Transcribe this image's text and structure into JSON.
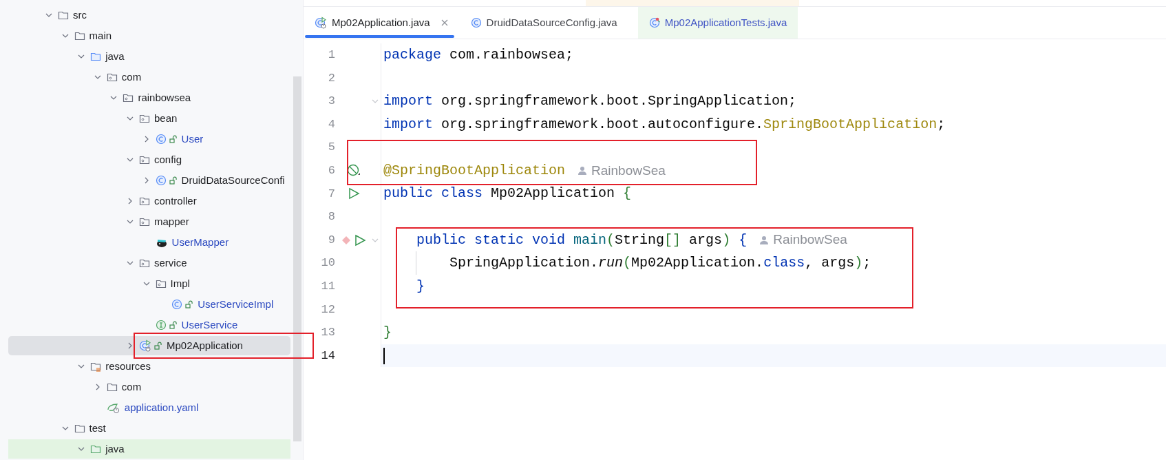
{
  "project_tree": {
    "items": [
      {
        "label": "src",
        "kind": "folder",
        "expanded": true,
        "selected": false,
        "children": [
          {
            "label": "main",
            "kind": "folder",
            "expanded": true,
            "selected": false,
            "children": [
              {
                "label": "java",
                "kind": "source-root",
                "expanded": true,
                "selected": false,
                "children": [
                  {
                    "label": "com",
                    "kind": "package",
                    "expanded": true,
                    "selected": false,
                    "children": [
                      {
                        "label": "rainbowsea",
                        "kind": "package",
                        "expanded": true,
                        "selected": false,
                        "children": [
                          {
                            "label": "bean",
                            "kind": "package",
                            "expanded": true,
                            "selected": false,
                            "children": [
                              {
                                "label": "User",
                                "kind": "class",
                                "expanded": false,
                                "selected": false,
                                "modified": true
                              }
                            ]
                          },
                          {
                            "label": "config",
                            "kind": "package",
                            "expanded": true,
                            "selected": false,
                            "children": [
                              {
                                "label": "DruidDataSourceConfi",
                                "kind": "class",
                                "expanded": false,
                                "selected": false,
                                "modified": false
                              }
                            ]
                          },
                          {
                            "label": "controller",
                            "kind": "package",
                            "expanded": false,
                            "selected": false
                          },
                          {
                            "label": "mapper",
                            "kind": "package",
                            "expanded": true,
                            "selected": false,
                            "children": [
                              {
                                "label": "UserMapper",
                                "kind": "mapper",
                                "selected": false,
                                "modified": true
                              }
                            ]
                          },
                          {
                            "label": "service",
                            "kind": "package",
                            "expanded": true,
                            "selected": false,
                            "children": [
                              {
                                "label": "Impl",
                                "kind": "package",
                                "expanded": true,
                                "selected": false,
                                "children": [
                                  {
                                    "label": "UserServiceImpl",
                                    "kind": "class",
                                    "selected": false,
                                    "modified": true
                                  }
                                ]
                              },
                              {
                                "label": "UserService",
                                "kind": "interface",
                                "selected": false,
                                "modified": true
                              }
                            ]
                          },
                          {
                            "label": "Mp02Application",
                            "kind": "app-class",
                            "expanded": false,
                            "selected": true,
                            "modified": false
                          }
                        ]
                      }
                    ]
                  }
                ]
              },
              {
                "label": "resources",
                "kind": "resources-root",
                "expanded": true,
                "selected": false,
                "children": [
                  {
                    "label": "com",
                    "kind": "folder",
                    "expanded": false,
                    "selected": false
                  },
                  {
                    "label": "application.yaml",
                    "kind": "yaml",
                    "selected": false,
                    "modified": true
                  }
                ]
              }
            ]
          },
          {
            "label": "test",
            "kind": "folder",
            "expanded": true,
            "selected": false,
            "children": [
              {
                "label": "java",
                "kind": "test-source-root",
                "expanded": true,
                "selected": false
              }
            ]
          }
        ]
      }
    ]
  },
  "editor": {
    "tabs": [
      {
        "label": "Mp02Application.java",
        "kind": "runnable",
        "selected": true,
        "closable": true,
        "modified": false
      },
      {
        "label": "DruidDataSourceConfig.java",
        "kind": "class",
        "selected": false,
        "closable": false,
        "modified": false
      },
      {
        "label": "Mp02ApplicationTests.java",
        "kind": "test",
        "selected": false,
        "closable": false,
        "modified": true
      }
    ],
    "lines": [
      {
        "number": "1",
        "current": false,
        "run": false,
        "bean_marker": false,
        "breakpoint": false,
        "fold": false,
        "tokens": [
          {
            "text": "package",
            "kind": "keyword"
          },
          {
            "text": " com.rainbowsea;",
            "kind": "plain"
          }
        ]
      },
      {
        "number": "2",
        "current": false,
        "run": false,
        "bean_marker": false,
        "breakpoint": false,
        "fold": false
      },
      {
        "number": "3",
        "current": false,
        "run": false,
        "bean_marker": false,
        "breakpoint": false,
        "fold": true,
        "tokens": [
          {
            "text": "import",
            "kind": "keyword"
          },
          {
            "text": " org.springframework.boot.SpringApplication;",
            "kind": "plain"
          }
        ]
      },
      {
        "number": "4",
        "current": false,
        "run": false,
        "bean_marker": false,
        "breakpoint": false,
        "fold": false,
        "tokens": [
          {
            "text": "import",
            "kind": "keyword"
          },
          {
            "text": " org.springframework.boot.autoconfigure.",
            "kind": "plain"
          },
          {
            "text": "SpringBootApplication",
            "kind": "annotation"
          },
          {
            "text": ";",
            "kind": "plain"
          }
        ]
      },
      {
        "number": "5",
        "current": false,
        "run": false,
        "bean_marker": false,
        "breakpoint": false,
        "fold": false
      },
      {
        "number": "6",
        "current": false,
        "run": false,
        "bean_marker": true,
        "breakpoint": false,
        "fold": false,
        "tokens": [
          {
            "text": "@SpringBootApplication",
            "kind": "annotation"
          },
          {
            "text": "RainbowSea",
            "kind": "author"
          }
        ]
      },
      {
        "number": "7",
        "current": false,
        "run": true,
        "bean_marker": false,
        "breakpoint": false,
        "fold": false,
        "tokens": [
          {
            "text": "public class",
            "kind": "keyword"
          },
          {
            "text": " Mp02Application ",
            "kind": "plain"
          },
          {
            "text": "{",
            "kind": "bracket"
          }
        ]
      },
      {
        "number": "8",
        "current": false,
        "run": false,
        "bean_marker": false,
        "breakpoint": false,
        "fold": false
      },
      {
        "number": "9",
        "current": false,
        "run": true,
        "bean_marker": false,
        "breakpoint": true,
        "fold": true,
        "tokens": [
          {
            "text": "    public static void",
            "kind": "keyword"
          },
          {
            "text": " main",
            "kind": "method"
          },
          {
            "text": "(",
            "kind": "bracket"
          },
          {
            "text": "String",
            "kind": "plain"
          },
          {
            "text": "[]",
            "kind": "bracket"
          },
          {
            "text": " args",
            "kind": "plain"
          },
          {
            "text": ")",
            "kind": "bracket"
          },
          {
            "text": " {",
            "kind": "brace"
          },
          {
            "text": "RainbowSea",
            "kind": "author"
          }
        ]
      },
      {
        "number": "10",
        "current": false,
        "run": false,
        "bean_marker": false,
        "breakpoint": false,
        "fold": false,
        "guide": true,
        "tokens": [
          {
            "text": "        SpringApplication.",
            "kind": "plain"
          },
          {
            "text": "run",
            "kind": "italic"
          },
          {
            "text": "(",
            "kind": "bracket"
          },
          {
            "text": "Mp02Application.",
            "kind": "plain"
          },
          {
            "text": "class",
            "kind": "keyword"
          },
          {
            "text": ", args",
            "kind": "plain"
          },
          {
            "text": ")",
            "kind": "bracket"
          },
          {
            "text": ";",
            "kind": "plain"
          }
        ]
      },
      {
        "number": "11",
        "current": false,
        "run": false,
        "bean_marker": false,
        "breakpoint": false,
        "fold": false,
        "tokens": [
          {
            "text": "    }",
            "kind": "brace"
          }
        ]
      },
      {
        "number": "12",
        "current": false,
        "run": false,
        "bean_marker": false,
        "breakpoint": false,
        "fold": false
      },
      {
        "number": "13",
        "current": false,
        "run": false,
        "bean_marker": false,
        "breakpoint": false,
        "fold": false,
        "tokens": [
          {
            "text": "}",
            "kind": "bracket"
          }
        ]
      },
      {
        "number": "14",
        "current": true,
        "run": false,
        "bean_marker": false,
        "breakpoint": false,
        "fold": false
      }
    ]
  }
}
